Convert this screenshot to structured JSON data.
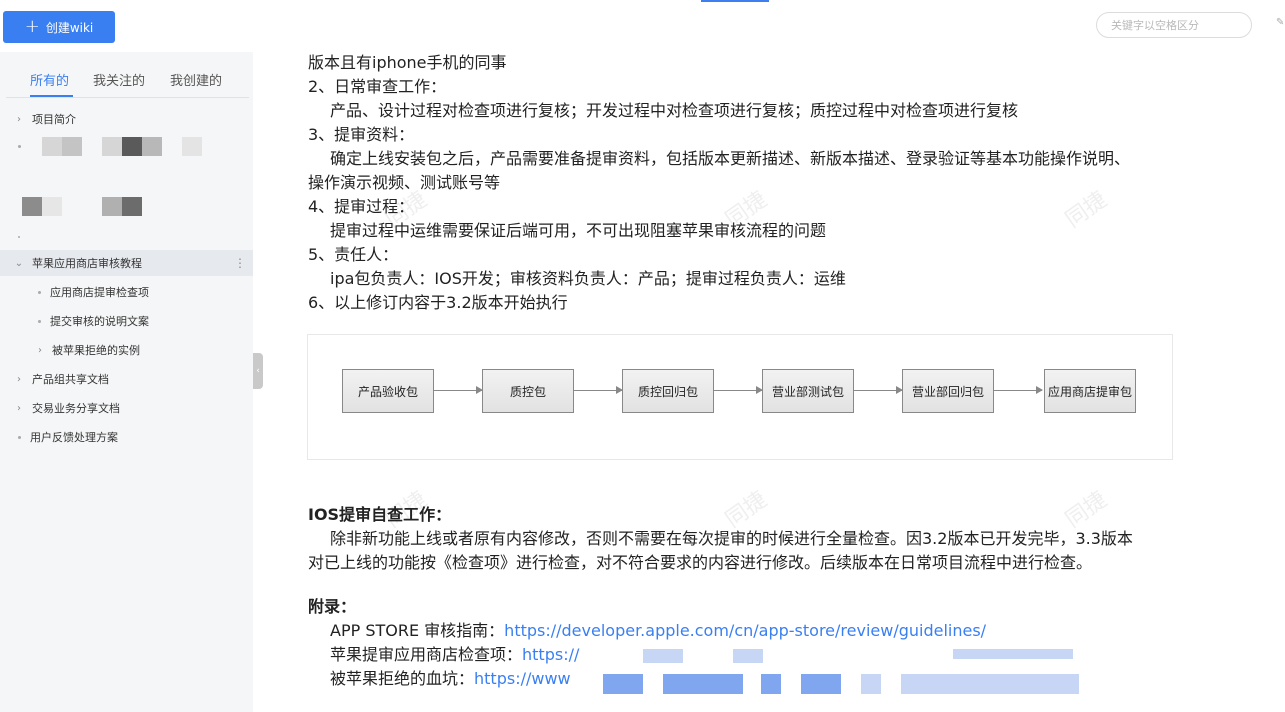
{
  "topbar": {
    "create_label": "创建wiki",
    "search_placeholder": "关键字以空格区分"
  },
  "sidebar": {
    "tabs": [
      {
        "label": "所有的",
        "active": true
      },
      {
        "label": "我关注的",
        "active": false
      },
      {
        "label": "我创建的",
        "active": false
      }
    ],
    "items": [
      {
        "label": "项目简介"
      },
      {
        "label": "苹果应用商店审核教程"
      },
      {
        "label": "应用商店提审检查项"
      },
      {
        "label": "提交审核的说明文案"
      },
      {
        "label": "被苹果拒绝的实例"
      },
      {
        "label": "产品组共享文档"
      },
      {
        "label": "交易业务分享文档"
      },
      {
        "label": "用户反馈处理方案"
      }
    ]
  },
  "content": {
    "lines": [
      "版本且有iphone手机的同事",
      "2、日常审查工作：",
      "产品、设计过程对检查项进行复核；开发过程中对检查项进行复核；质控过程中对检查项进行复核",
      "3、提审资料：",
      "确定上线安装包之后，产品需要准备提审资料，包括版本更新描述、新版本描述、登录验证等基本功能操作说明、",
      "操作演示视频、测试账号等",
      "4、提审过程：",
      "提审过程中运维需要保证后端可用，不可出现阻塞苹果审核流程的问题",
      "5、责任人：",
      "ipa包负责人：IOS开发；审核资料负责人：产品；提审过程负责人：运维",
      "6、以上修订内容于3.2版本开始执行"
    ],
    "flow": [
      "产品验收包",
      "质控包",
      "质控回归包",
      "营业部测试包",
      "营业部回归包",
      "应用商店提审包"
    ],
    "ios_title": "IOS提审自查工作：",
    "ios_lines": [
      "除非新功能上线或者原有内容修改，否则不需要在每次提审的时候进行全量检查。因3.2版本已开发完毕，3.3版本",
      "对已上线的功能按《检查项》进行检查，对不符合要求的内容进行修改。后续版本在日常项目流程中进行检查。"
    ],
    "appendix_title": "附录：",
    "appendix": [
      {
        "label": "APP STORE 审核指南：",
        "link": "https://developer.apple.com/cn/app-store/review/guidelines/"
      },
      {
        "label": "苹果提审应用商店检查项：",
        "link": "https://"
      },
      {
        "label": "被苹果拒绝的血坑：",
        "link": "https://www"
      }
    ]
  },
  "watermark_text": "同捷"
}
